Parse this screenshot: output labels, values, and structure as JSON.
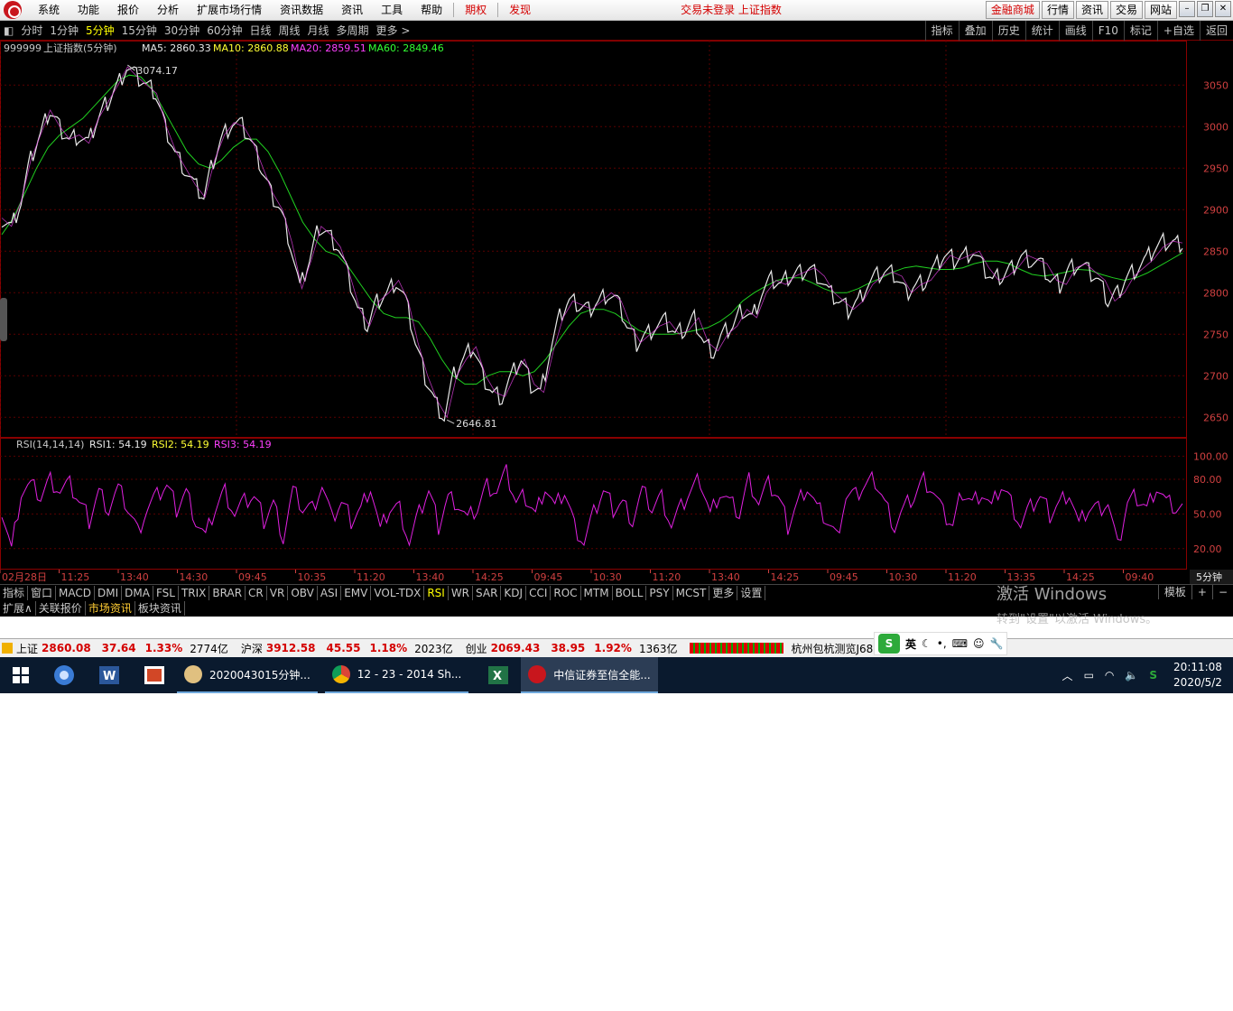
{
  "menu": {
    "items": [
      "系统",
      "功能",
      "报价",
      "分析",
      "扩展市场行情",
      "资讯数据",
      "资讯",
      "工具",
      "帮助"
    ],
    "red_items": [
      "期权",
      "发现"
    ],
    "status": "交易未登录  上证指数",
    "right_buttons": [
      "金融商城",
      "行情",
      "资讯",
      "交易",
      "网站"
    ]
  },
  "periodbar": {
    "items": [
      "分时",
      "1分钟",
      "5分钟",
      "15分钟",
      "30分钟",
      "60分钟",
      "日线",
      "周线",
      "月线",
      "多周期",
      "更多 >"
    ],
    "active": "5分钟",
    "right": [
      "指标",
      "叠加",
      "历史",
      "统计",
      "画线",
      "F10",
      "标记",
      "+自选",
      "返回"
    ]
  },
  "chart_header": {
    "code": "999999",
    "name": "上证指数(5分钟)",
    "ma5": "MA5: 2860.33",
    "ma10": "MA10: 2860.88",
    "ma20": "MA20: 2859.51",
    "ma60": "MA60: 2849.46"
  },
  "rsi_header": {
    "name": "RSI(14,14,14)",
    "rsi1": "RSI1: 54.19",
    "rsi2": "RSI2: 54.19",
    "rsi3": "RSI3: 54.19"
  },
  "chart_data": {
    "type": "candlestick-line",
    "price_axis": [
      "3050",
      "3000",
      "2950",
      "2900",
      "2850",
      "2800",
      "2750",
      "2700",
      "2650"
    ],
    "price_range": [
      2634,
      3084
    ],
    "high_label": "3074.17",
    "low_label": "2646.81",
    "rsi_axis": [
      "100.00",
      "80.00",
      "50.00",
      "20.00"
    ],
    "rsi_range": [
      5,
      105
    ],
    "time_labels": [
      "02月28日",
      "11:25",
      "13:40",
      "14:30",
      "09:45",
      "10:35",
      "11:20",
      "13:40",
      "14:25",
      "09:45",
      "10:30",
      "11:20",
      "13:40",
      "14:25",
      "09:45",
      "10:30",
      "11:20",
      "13:35",
      "14:25",
      "09:40"
    ],
    "period_label": "5分钟",
    "price_path": [
      2890,
      2880,
      2910,
      2960,
      2990,
      3020,
      3000,
      2985,
      2990,
      2980,
      3010,
      3030,
      3050,
      3072,
      3060,
      3050,
      3040,
      3000,
      2970,
      2950,
      2930,
      2915,
      2960,
      2990,
      3005,
      3000,
      2980,
      2950,
      2920,
      2900,
      2860,
      2805,
      2840,
      2880,
      2870,
      2855,
      2820,
      2780,
      2760,
      2790,
      2800,
      2815,
      2790,
      2740,
      2700,
      2670,
      2650,
      2700,
      2720,
      2735,
      2700,
      2680,
      2675,
      2700,
      2720,
      2690,
      2680,
      2730,
      2770,
      2790,
      2785,
      2780,
      2790,
      2800,
      2790,
      2760,
      2740,
      2750,
      2760,
      2765,
      2750,
      2755,
      2770,
      2740,
      2730,
      2750,
      2760,
      2780,
      2770,
      2800,
      2815,
      2810,
      2820,
      2825,
      2830,
      2820,
      2800,
      2790,
      2780,
      2790,
      2810,
      2820,
      2825,
      2820,
      2800,
      2810,
      2815,
      2830,
      2845,
      2840,
      2845,
      2850,
      2830,
      2815,
      2820,
      2830,
      2845,
      2840,
      2835,
      2815,
      2810,
      2830,
      2835,
      2825,
      2815,
      2790,
      2800,
      2820,
      2830,
      2840,
      2855,
      2862,
      2860
    ],
    "ma_path": [
      2870,
      2890,
      2920,
      2950,
      2975,
      2990,
      3000,
      3010,
      3025,
      3040,
      3055,
      3062,
      3060,
      3045,
      3020,
      2995,
      2970,
      2955,
      2950,
      2960,
      2975,
      2985,
      2985,
      2970,
      2945,
      2915,
      2885,
      2865,
      2850,
      2845,
      2830,
      2810,
      2790,
      2775,
      2770,
      2770,
      2765,
      2745,
      2720,
      2700,
      2690,
      2690,
      2700,
      2705,
      2705,
      2700,
      2705,
      2720,
      2740,
      2760,
      2775,
      2780,
      2780,
      2775,
      2765,
      2755,
      2750,
      2750,
      2750,
      2752,
      2755,
      2758,
      2765,
      2775,
      2790,
      2800,
      2808,
      2815,
      2818,
      2818,
      2812,
      2805,
      2800,
      2800,
      2805,
      2812,
      2818,
      2825,
      2830,
      2832,
      2830,
      2828,
      2828,
      2830,
      2835,
      2838,
      2838,
      2835,
      2828,
      2822,
      2820,
      2822,
      2825,
      2828,
      2827,
      2822,
      2818,
      2815,
      2818,
      2824,
      2832,
      2840,
      2848
    ],
    "rsi_path": [
      55,
      20,
      70,
      75,
      65,
      80,
      70,
      75,
      60,
      45,
      70,
      55,
      72,
      55,
      35,
      55,
      65,
      75,
      55,
      70,
      45,
      30,
      55,
      70,
      50,
      60,
      65,
      45,
      60,
      30,
      70,
      55,
      55,
      75,
      45,
      60,
      45,
      55,
      75,
      35,
      55,
      55,
      25,
      50,
      70,
      40,
      65,
      60,
      45,
      55,
      75,
      70,
      85,
      60,
      65,
      50,
      75,
      55,
      70,
      40,
      25,
      50,
      70,
      55,
      60,
      45,
      70,
      55,
      65,
      40,
      55,
      70,
      80,
      50,
      70,
      60,
      50,
      80,
      60,
      75,
      65,
      40,
      60,
      75,
      55,
      45,
      30,
      65,
      65,
      75,
      80,
      60,
      40,
      55,
      65,
      80,
      70,
      50,
      40,
      70,
      60,
      70,
      55,
      75,
      60,
      40,
      55,
      65,
      50,
      60,
      70,
      40,
      55,
      55,
      60,
      20,
      60,
      65,
      55,
      75,
      60,
      55
    ]
  },
  "ind_tabs": [
    "指标",
    "窗口",
    "MACD",
    "DMI",
    "DMA",
    "FSL",
    "TRIX",
    "BRAR",
    "CR",
    "VR",
    "OBV",
    "ASI",
    "EMV",
    "VOL-TDX",
    "RSI",
    "WR",
    "SAR",
    "KDJ",
    "CCI",
    "ROC",
    "MTM",
    "BOLL",
    "PSY",
    "MCST",
    "更多",
    "设置"
  ],
  "ind_active": "RSI",
  "ind_right": [
    "模板",
    "+",
    "−"
  ],
  "ext_tabs": [
    "扩展∧",
    "关联报价",
    "市场资讯",
    "板块资讯"
  ],
  "watermark": {
    "line1": "激活 Windows",
    "line2": "转到\"设置\"以激活 Windows。"
  },
  "ticker": {
    "sh_label": "上证",
    "sh_val": "2860.08",
    "sh_chg": "37.64",
    "sh_pct": "1.33%",
    "sh_amt": "2774亿",
    "hs_label": "沪深",
    "hs_val": "3912.58",
    "hs_chg": "45.55",
    "hs_pct": "1.18%",
    "hs_amt": "2023亿",
    "cy_label": "创业",
    "cy_val": "2069.43",
    "cy_chg": "38.95",
    "cy_pct": "1.92%",
    "cy_amt": "1363亿",
    "server": "杭州包杭测览J68"
  },
  "ime": {
    "lang": "英"
  },
  "taskbar": {
    "tasks": [
      "2020043015分钟...",
      "12 - 23 - 2014 Sh...",
      "中信证券至信全能..."
    ],
    "time": "20:11:08",
    "date": "2020/5/2"
  }
}
